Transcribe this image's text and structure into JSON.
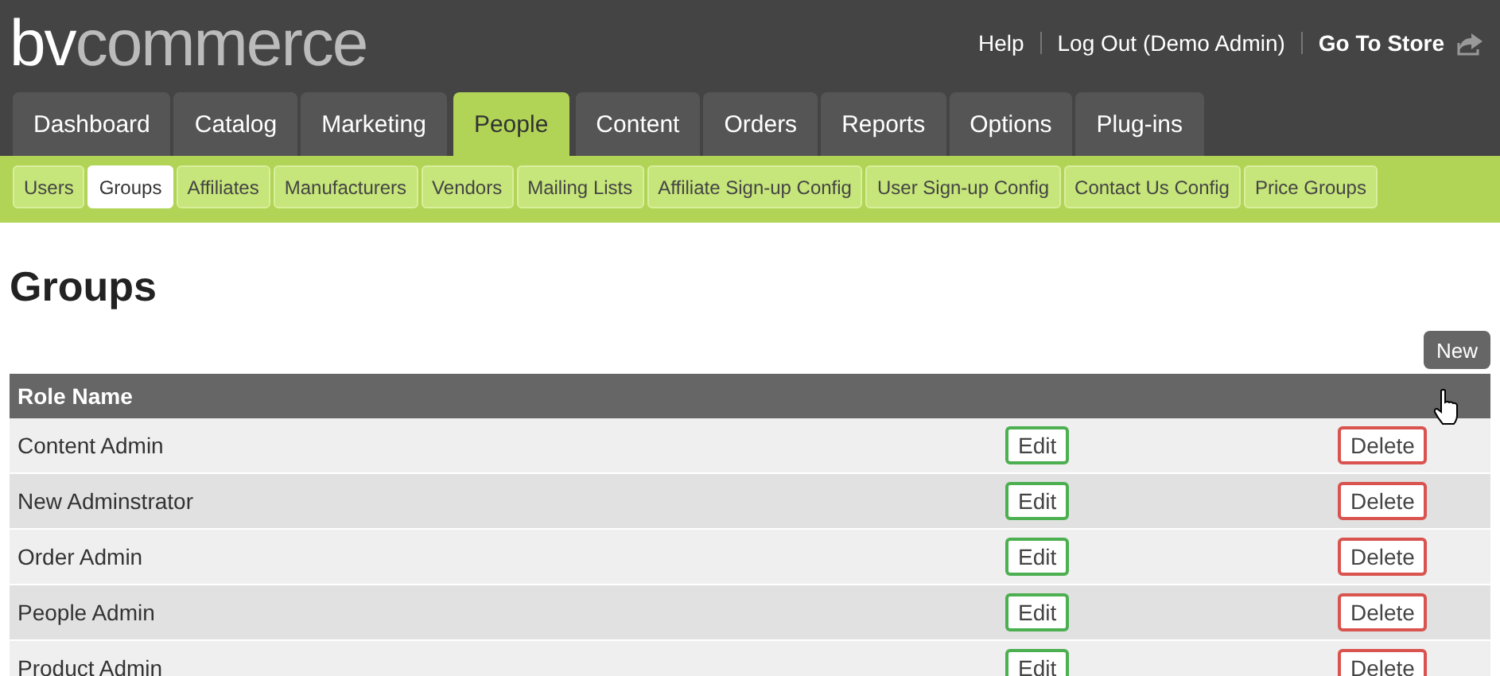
{
  "logo": {
    "first": "bv",
    "second": "commerce"
  },
  "top_links": [
    {
      "label": "Help",
      "kind": "plain"
    },
    {
      "label": "Log Out (Demo Admin)",
      "kind": "plain"
    },
    {
      "label": "Go To Store",
      "kind": "store"
    }
  ],
  "tabs": [
    {
      "label": "Dashboard",
      "selected": false
    },
    {
      "label": "Catalog",
      "selected": false
    },
    {
      "label": "Marketing",
      "selected": false
    },
    {
      "label": "People",
      "selected": true
    },
    {
      "label": "Content",
      "selected": false
    },
    {
      "label": "Orders",
      "selected": false
    },
    {
      "label": "Reports",
      "selected": false
    },
    {
      "label": "Options",
      "selected": false
    },
    {
      "label": "Plug-ins",
      "selected": false
    }
  ],
  "subtabs": [
    {
      "label": "Users",
      "selected": false
    },
    {
      "label": "Groups",
      "selected": true
    },
    {
      "label": "Affiliates",
      "selected": false
    },
    {
      "label": "Manufacturers",
      "selected": false
    },
    {
      "label": "Vendors",
      "selected": false
    },
    {
      "label": "Mailing Lists",
      "selected": false
    },
    {
      "label": "Affiliate Sign-up Config",
      "selected": false
    },
    {
      "label": "User Sign-up Config",
      "selected": false
    },
    {
      "label": "Contact Us Config",
      "selected": false
    },
    {
      "label": "Price Groups",
      "selected": false
    }
  ],
  "page_title": "Groups",
  "new_button": "New",
  "table": {
    "columns": [
      "Role Name"
    ],
    "rows": [
      {
        "name": "Content Admin",
        "edit": "Edit",
        "delete": "Delete"
      },
      {
        "name": "New Adminstrator",
        "edit": "Edit",
        "delete": "Delete"
      },
      {
        "name": "Order Admin",
        "edit": "Edit",
        "delete": "Delete"
      },
      {
        "name": "People Admin",
        "edit": "Edit",
        "delete": "Delete"
      },
      {
        "name": "Product Admin",
        "edit": "Edit",
        "delete": "Delete"
      }
    ]
  }
}
